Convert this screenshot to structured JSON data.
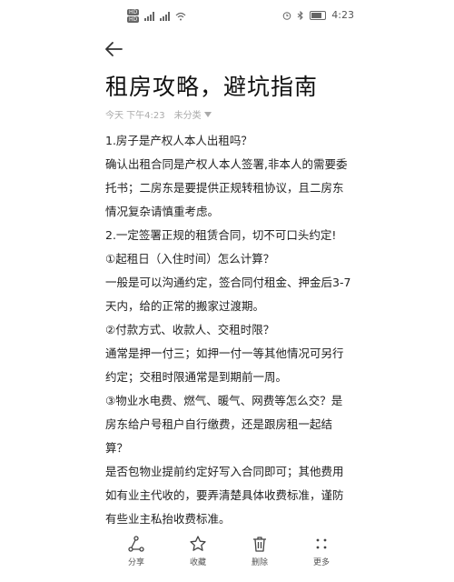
{
  "status_bar": {
    "sim1": "HD",
    "sim2": "HD",
    "time": "4:23",
    "battery_level": 0.7
  },
  "article": {
    "title": "租房攻略，避坑指南",
    "date": "今天 下午4:23",
    "category": "未分类"
  },
  "content_lines": [
    "1.房子是产权人本人出租吗？",
    "确认出租合同是产权人本人签署,非本人的需要委托书；二房东是要提供正规转租协议，且二房东情况复杂请慎重考虑。",
    "2.一定签署正规的租赁合同，切不可口头约定!",
    "①起租日（入住时间）怎么计算？",
    "一般是可以沟通约定，签合同付租金、押金后3-7天内，给的正常的搬家过渡期。",
    "②付款方式、收款人、交租时限？",
    "通常是押一付三；如押一付一等其他情况可另行约定；交租时限通常是到期前一周。",
    "③物业水电费、燃气、暖气、网费等怎么交？是房东给户号租户自行缴费，还是跟房租一起结算？",
    "是否包物业提前约定好写入合同即可；其他费用如有业主代收的，要弄清楚具体收费标准，谨防有些业主私抬收费标准。"
  ],
  "actions": {
    "share": "分享",
    "favorite": "收藏",
    "delete": "删除",
    "more": "更多"
  }
}
